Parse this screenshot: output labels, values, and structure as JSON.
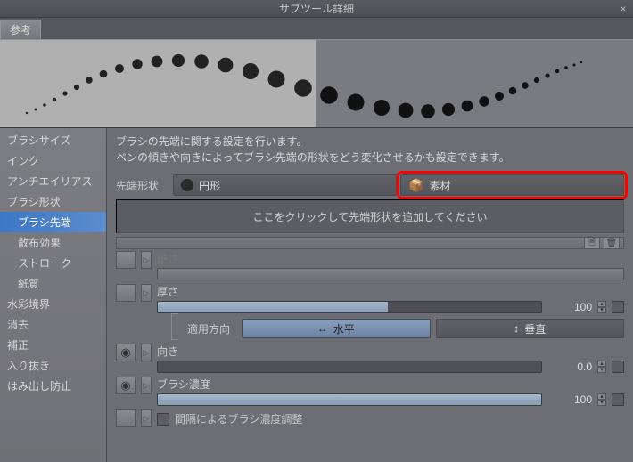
{
  "window": {
    "title": "サブツール詳細"
  },
  "ref_tab": "参考",
  "sidebar": {
    "items": [
      {
        "label": "ブラシサイズ",
        "indent": false,
        "active": false
      },
      {
        "label": "インク",
        "indent": false,
        "active": false
      },
      {
        "label": "アンチエイリアス",
        "indent": false,
        "active": false
      },
      {
        "label": "ブラシ形状",
        "indent": false,
        "active": false
      },
      {
        "label": "ブラシ先端",
        "indent": true,
        "active": true
      },
      {
        "label": "散布効果",
        "indent": true,
        "active": false
      },
      {
        "label": "ストローク",
        "indent": true,
        "active": false
      },
      {
        "label": "紙質",
        "indent": true,
        "active": false
      },
      {
        "label": "水彩境界",
        "indent": false,
        "active": false
      },
      {
        "label": "消去",
        "indent": false,
        "active": false
      },
      {
        "label": "補正",
        "indent": false,
        "active": false
      },
      {
        "label": "入り抜き",
        "indent": false,
        "active": false
      },
      {
        "label": "はみ出し防止",
        "indent": false,
        "active": false
      }
    ]
  },
  "description": {
    "line1": "ブラシの先端に関する設定を行います。",
    "line2": "ペンの傾きや向きによってブラシ先端の形状をどう変化させるかも設定できます。"
  },
  "tip_shape": {
    "label": "先端形状",
    "circle": "円形",
    "material": "素材"
  },
  "drop_zone": "ここをクリックして先端形状を追加してください",
  "params": {
    "hardness": {
      "label": "硬さ",
      "value": "",
      "fill": 100,
      "disabled": true
    },
    "thickness": {
      "label": "厚さ",
      "value": "100",
      "fill": 60,
      "disabled": false
    },
    "direction": {
      "label": "適用方向",
      "horizontal": "水平",
      "vertical": "垂直"
    },
    "angle": {
      "label": "向き",
      "value": "0.0",
      "fill": 0,
      "disabled": false
    },
    "density": {
      "label": "ブラシ濃度",
      "value": "100",
      "fill": 100,
      "disabled": false
    },
    "spacing_adjust": "間隔によるブラシ濃度調整"
  },
  "icons": {
    "close": "×",
    "eye": "◉",
    "expand": "▷",
    "up": "▴",
    "down": "▾",
    "horiz": "↔",
    "vert": "↕",
    "doc": "🗎",
    "trash": "🗑",
    "material": "📦"
  }
}
